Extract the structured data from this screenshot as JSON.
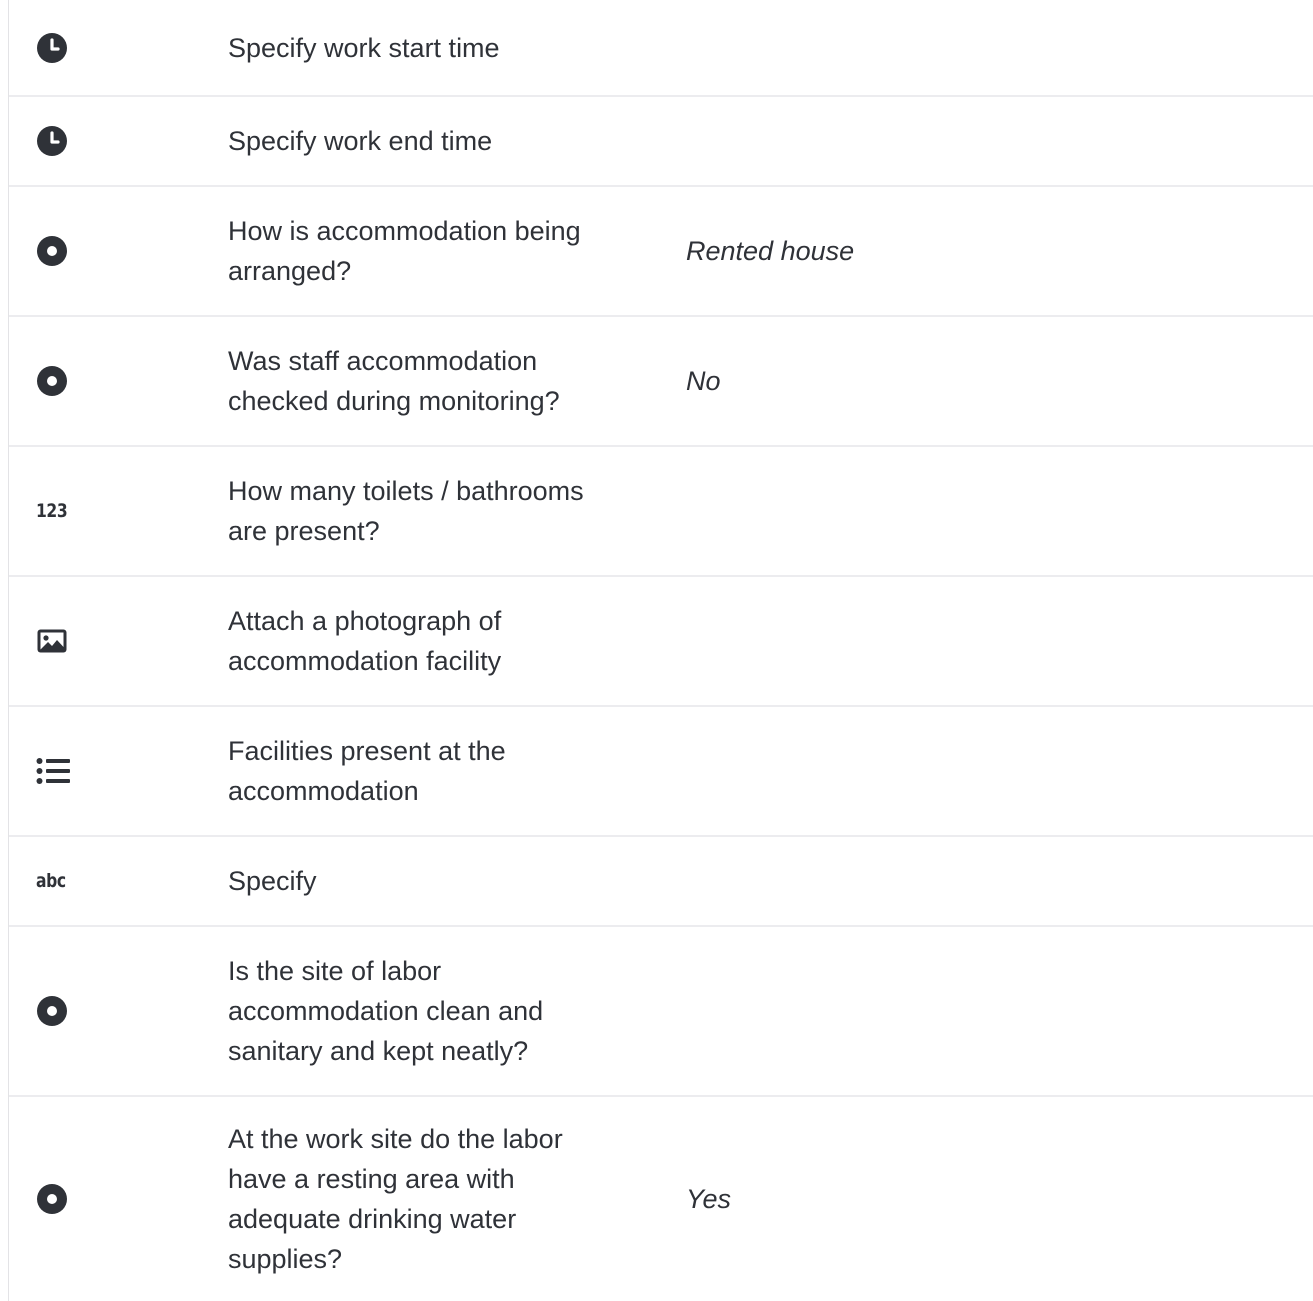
{
  "rows": [
    {
      "icon": "clock-icon",
      "question": "Specify work start time",
      "answer": ""
    },
    {
      "icon": "clock-icon",
      "question": "Specify work end time",
      "answer": ""
    },
    {
      "icon": "radio-icon",
      "question": "How is accommodation being arranged?",
      "answer": "Rented house"
    },
    {
      "icon": "radio-icon",
      "question": "Was staff accommodation checked during monitoring?",
      "answer": "No"
    },
    {
      "icon": "number-icon",
      "icon_text": "123",
      "question": "How many toilets / bathrooms are present?",
      "answer": ""
    },
    {
      "icon": "image-icon",
      "question": "Attach a photograph of accommodation facility",
      "answer": ""
    },
    {
      "icon": "list-icon",
      "question": "Facilities present at the accommodation",
      "answer": ""
    },
    {
      "icon": "text-icon",
      "icon_text": "abc",
      "question": "Specify",
      "answer": ""
    },
    {
      "icon": "radio-icon",
      "question": "Is the site of labor accommodation clean and sanitary and kept neatly?",
      "answer": ""
    },
    {
      "icon": "radio-icon",
      "question": "At the work site do the labor have a resting area with adequate drinking water supplies?",
      "answer": "Yes"
    }
  ],
  "colors": {
    "text": "#2f3238",
    "icon": "#2f3238",
    "divider": "#ececef"
  }
}
